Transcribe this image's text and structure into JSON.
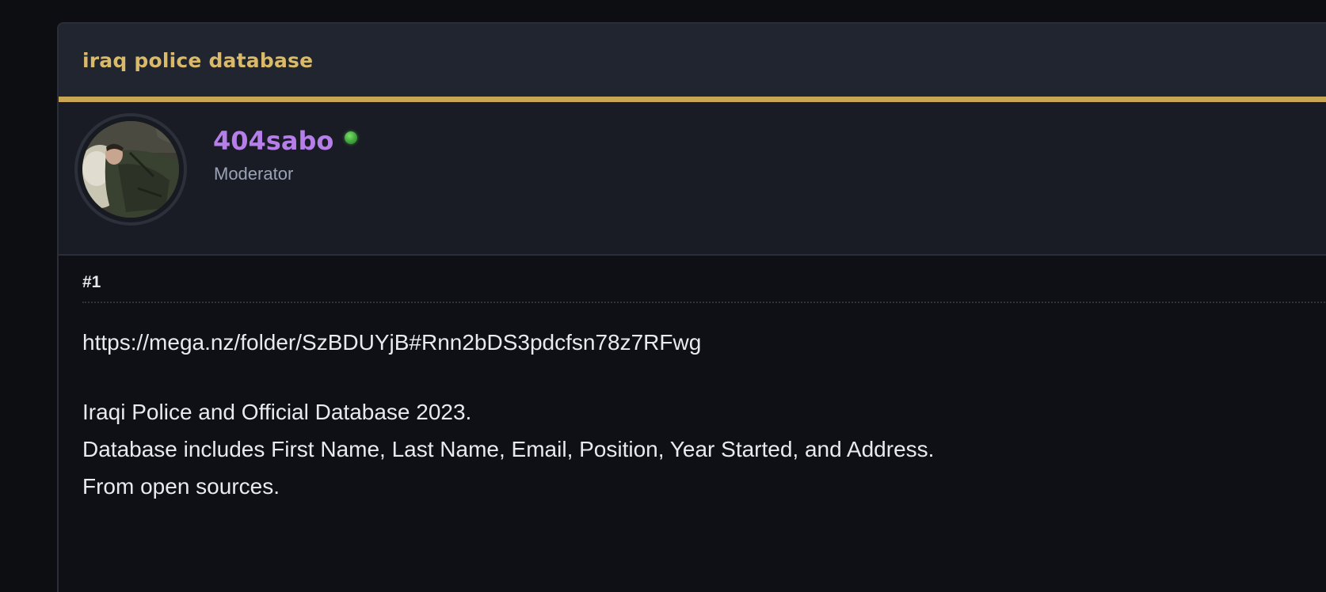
{
  "thread": {
    "title": "iraq police database"
  },
  "author": {
    "username": "404sabo",
    "role": "Moderator",
    "status": "online",
    "colors": {
      "username": "#b57ee8",
      "title": "#d9b96a",
      "accent": "#c9a656",
      "online": "#4bbf44"
    }
  },
  "post": {
    "number": "#1",
    "link": "https://mega.nz/folder/SzBDUYjB#Rnn2bDS3pdcfsn78z7RFwg",
    "lines": [
      "Iraqi Police and Official Database 2023.",
      "Database includes First Name, Last Name, Email, Position, Year Started, and Address.",
      "From open sources."
    ]
  }
}
